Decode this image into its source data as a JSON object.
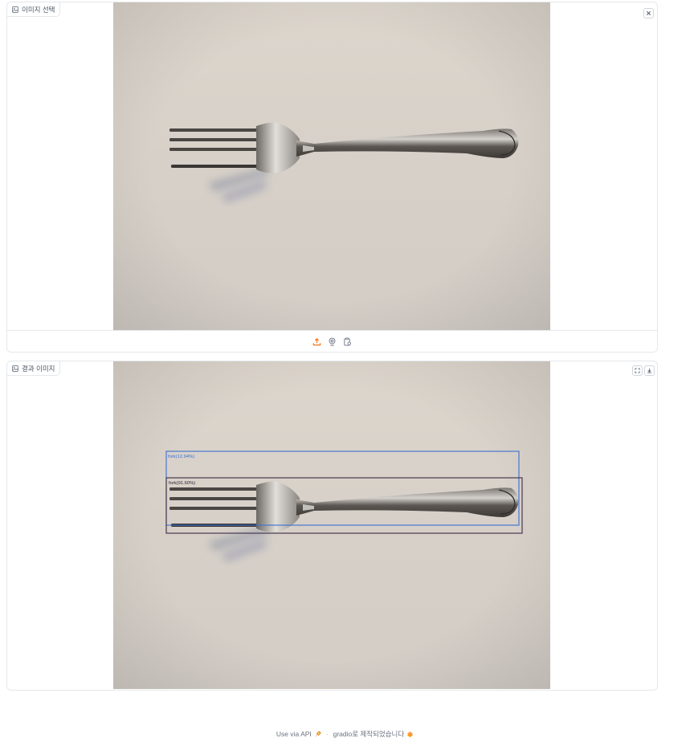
{
  "input_panel": {
    "label": "이미지 선택",
    "clear_icon": "close-icon",
    "sources": [
      "upload-icon",
      "webcam-icon",
      "clipboard-icon"
    ]
  },
  "output_panel": {
    "label": "결과 이미지",
    "detections": [
      {
        "text": "fork(12.94%)",
        "color": "#3b6fd1"
      },
      {
        "text": "fork(91.60%)",
        "color": "#3c2a44"
      }
    ]
  },
  "footer": {
    "api_label": "Use via API",
    "separator": "·",
    "built_with": "gradio로 제작되었습니다"
  },
  "colors": {
    "accent": "#f97316",
    "border": "#e5e7eb",
    "photo_bg": "#d9d3cb"
  }
}
